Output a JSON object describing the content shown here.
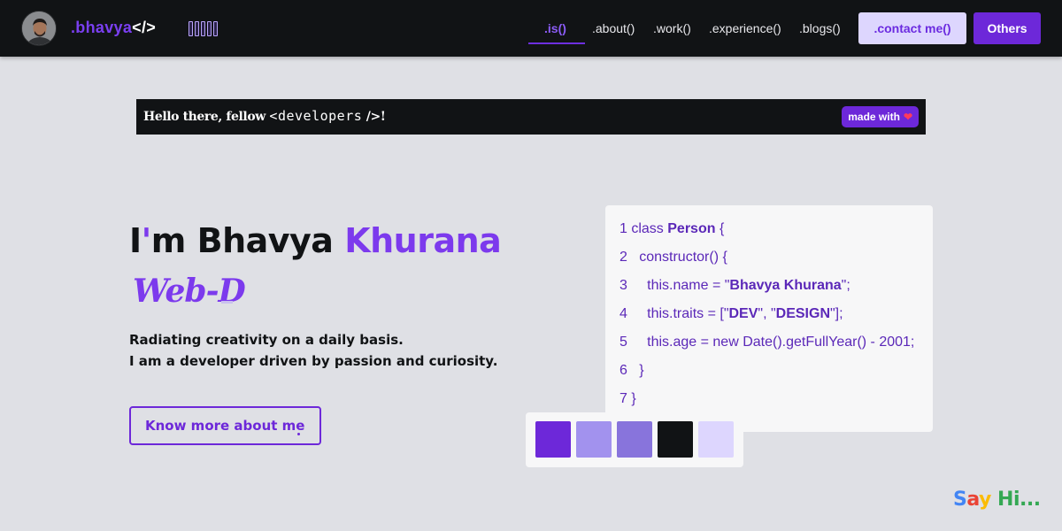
{
  "nav": {
    "logo_prefix": ".bhavya",
    "logo_suffix": "</>",
    "links": [
      {
        "label": ".is()",
        "active": true
      },
      {
        "label": ".about()",
        "active": false
      },
      {
        "label": ".work()",
        "active": false
      },
      {
        "label": ".experience()",
        "active": false
      },
      {
        "label": ".blogs()",
        "active": false
      }
    ],
    "contact_label": ".contact me()",
    "others_label": "Others",
    "bars_icon": "audio-bars-icon"
  },
  "banner": {
    "text_before": "Hello there, fellow",
    "tag_open": "<",
    "tag_name": "developers",
    "tag_close": "/>",
    "text_after": "!",
    "made_with_label": "made with",
    "heart_icon": "heart-icon"
  },
  "hero": {
    "first": "I",
    "apostrophe": "'",
    "middle": "m Bhavya ",
    "last": "Khurana",
    "typed_role": "Web-D",
    "line1": "Radiating creativity on a daily basis.",
    "line2": "I am a developer driven by passion and curiosity.",
    "cta_label": "Know more about me"
  },
  "code": {
    "lines": [
      {
        "num": "1",
        "indent": " ",
        "segments": [
          {
            "t": "class ",
            "b": false
          },
          {
            "t": "Person",
            "b": true
          },
          {
            "t": " {",
            "b": false
          }
        ]
      },
      {
        "num": "2",
        "indent": "   ",
        "segments": [
          {
            "t": "constructor() {",
            "b": false
          }
        ]
      },
      {
        "num": "3",
        "indent": "     ",
        "segments": [
          {
            "t": "this.name = \"",
            "b": false
          },
          {
            "t": "Bhavya Khurana",
            "b": true
          },
          {
            "t": "\";",
            "b": false
          }
        ]
      },
      {
        "num": "4",
        "indent": "     ",
        "segments": [
          {
            "t": "this.traits = [\"",
            "b": false
          },
          {
            "t": "DEV",
            "b": true
          },
          {
            "t": "\", \"",
            "b": false
          },
          {
            "t": "DESIGN",
            "b": true
          },
          {
            "t": "\"];",
            "b": false
          }
        ]
      },
      {
        "num": "5",
        "indent": "     ",
        "segments": [
          {
            "t": "this.age = new Date().getFullYear() - 2001;",
            "b": false
          }
        ]
      },
      {
        "num": "6",
        "indent": "   ",
        "segments": [
          {
            "t": "}",
            "b": false
          }
        ]
      },
      {
        "num": "7",
        "indent": " ",
        "segments": [
          {
            "t": "}",
            "b": false
          }
        ]
      }
    ]
  },
  "swatches": [
    "#6d28d9",
    "#a292ee",
    "#8874dc",
    "#111315",
    "#ddd6fe"
  ],
  "say_hi": {
    "letters": [
      {
        "ch": "S",
        "color": "#4285f4"
      },
      {
        "ch": "a",
        "color": "#ea4335"
      },
      {
        "ch": "y",
        "color": "#fbbc05"
      },
      {
        "ch": " ",
        "color": "#000000"
      },
      {
        "ch": "H",
        "color": "#34a853"
      },
      {
        "ch": "i",
        "color": "#34a853"
      },
      {
        "ch": "...",
        "color": "#34a853"
      }
    ]
  }
}
